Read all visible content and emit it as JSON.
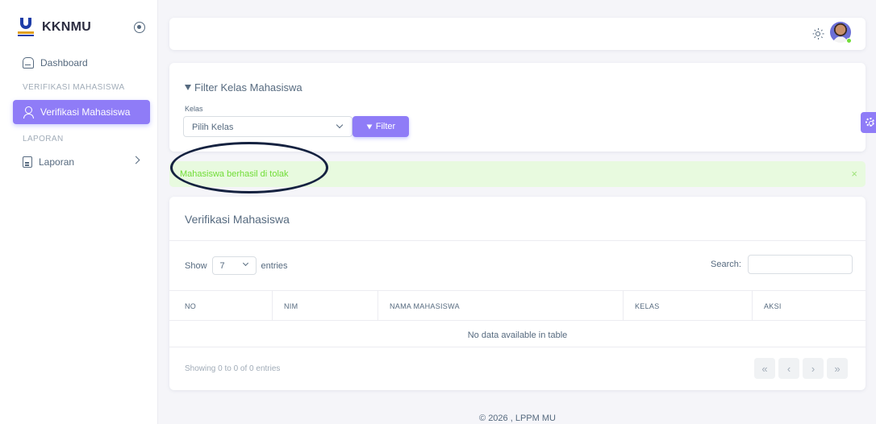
{
  "brand": {
    "name": "KKNMU"
  },
  "sidebar": {
    "dashboard": "Dashboard",
    "section_verifikasi": "VERIFIKASI MAHASISWA",
    "verifikasi": "Verifikasi Mahasiswa",
    "section_laporan": "LAPORAN",
    "laporan": "Laporan"
  },
  "filter": {
    "title": "Filter Kelas Mahasiswa",
    "label": "Kelas",
    "select_value": "Pilih Kelas",
    "button": "Filter"
  },
  "alert": {
    "message": "Mahasiswa berhasil di tolak",
    "close": "×"
  },
  "table": {
    "title": "Verifikasi Mahasiswa",
    "show": "Show",
    "entries_value": "7",
    "entries": "entries",
    "search_label": "Search:",
    "columns": [
      "NO",
      "NIM",
      "NAMA MAHASISWA",
      "KELAS",
      "AKSI"
    ],
    "empty": "No data available in table",
    "info": "Showing 0 to 0 of 0 entries",
    "pager": [
      "«",
      "‹",
      "›",
      "»"
    ]
  },
  "footer": {
    "text": "© 2026 , LPPM MU"
  },
  "colors": {
    "primary": "#8f7cf7",
    "success": "#71dd37",
    "alert_bg": "#e8fadf"
  }
}
